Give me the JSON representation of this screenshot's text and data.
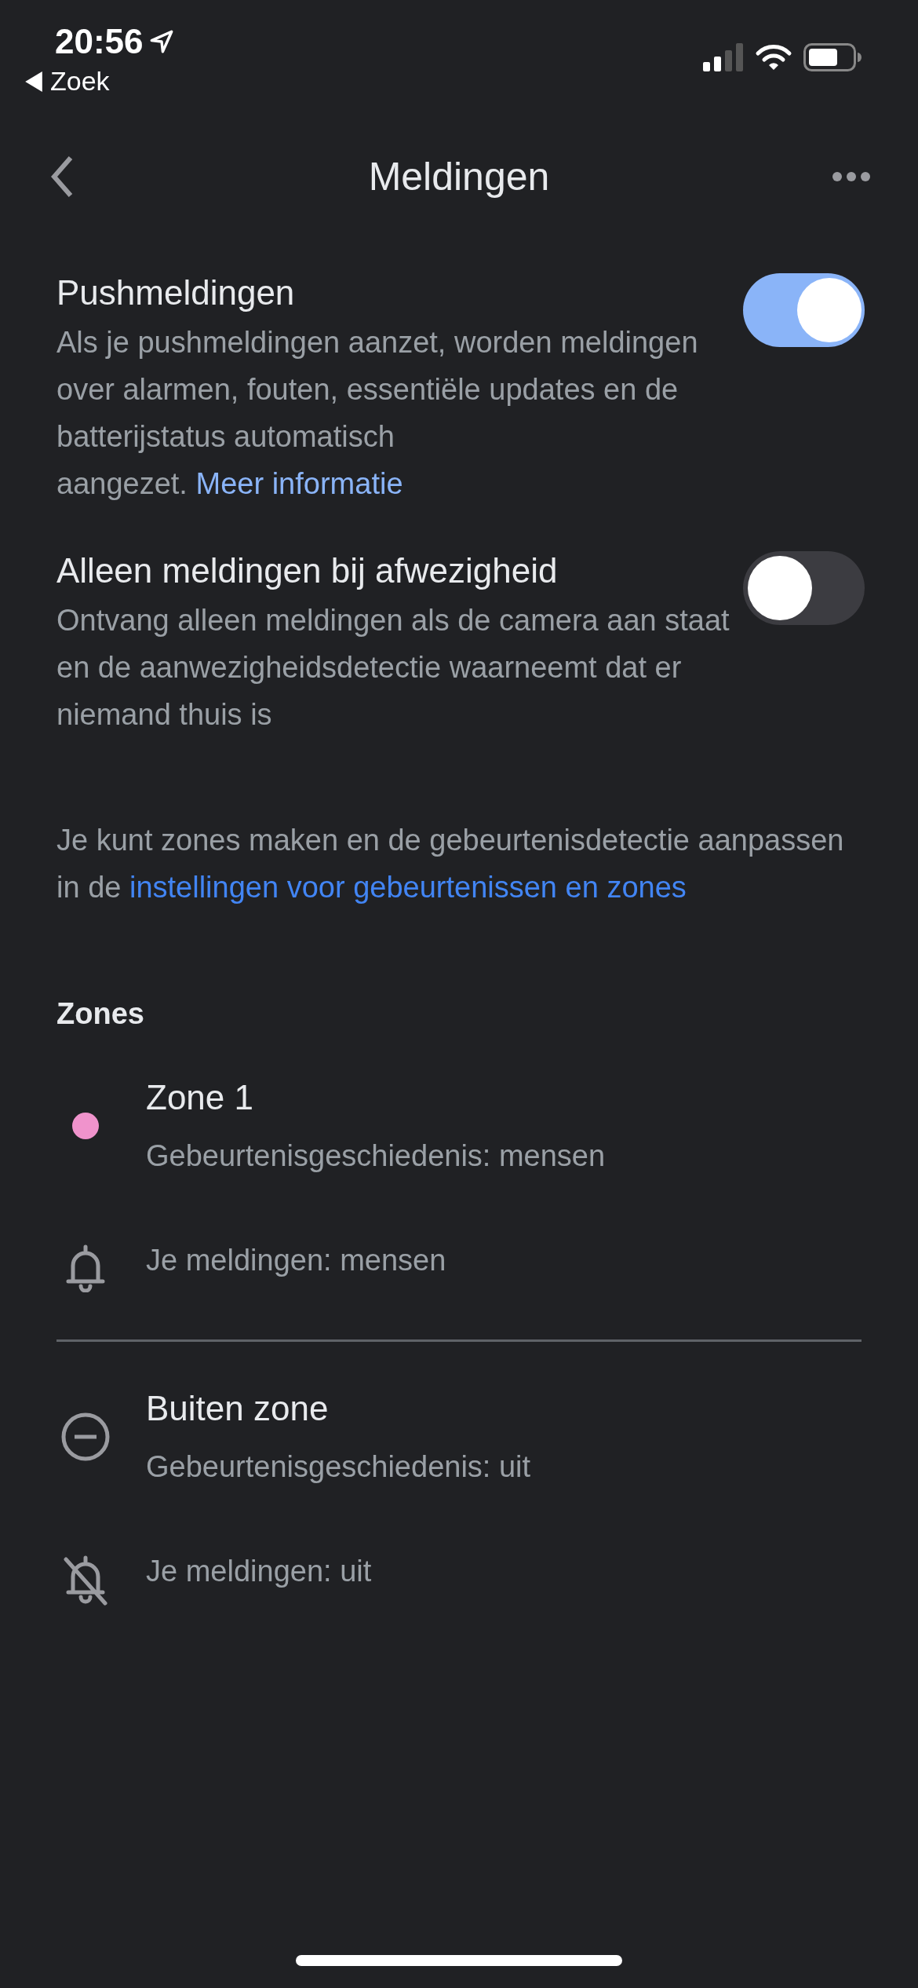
{
  "status_bar": {
    "time": "20:56",
    "back_app": "Zoek"
  },
  "header": {
    "title": "Meldingen"
  },
  "settings": [
    {
      "title": "Pushmeldingen",
      "description": "Als je pushmeldingen aanzet, worden meldingen over alarmen, fouten, essentiële updates en de batterijstatus automatisch aangezet.",
      "link": "Meer informatie",
      "on": true
    },
    {
      "title": "Alleen meldingen bij afwezigheid",
      "description": "Ontvang alleen meldingen als de camera aan staat en de aanwezigheidsdetectie waarneemt dat er niemand thuis is",
      "on": false
    }
  ],
  "info": {
    "text": "Je kunt zones maken en de gebeurtenisdetectie aanpassen in de",
    "link": "instellingen voor gebeurtenissen en zones"
  },
  "zones_heading": "Zones",
  "zones": [
    {
      "name": "Zone 1",
      "history": "Gebeurtenisgeschiedenis: mensen",
      "kind": "dot",
      "color": "#f093cc",
      "notifications": "Je meldingen: mensen",
      "notifications_on": true
    },
    {
      "name": "Buiten zone",
      "history": "Gebeurtenisgeschiedenis: uit",
      "kind": "outside",
      "notifications": "Je meldingen: uit",
      "notifications_on": false
    }
  ]
}
